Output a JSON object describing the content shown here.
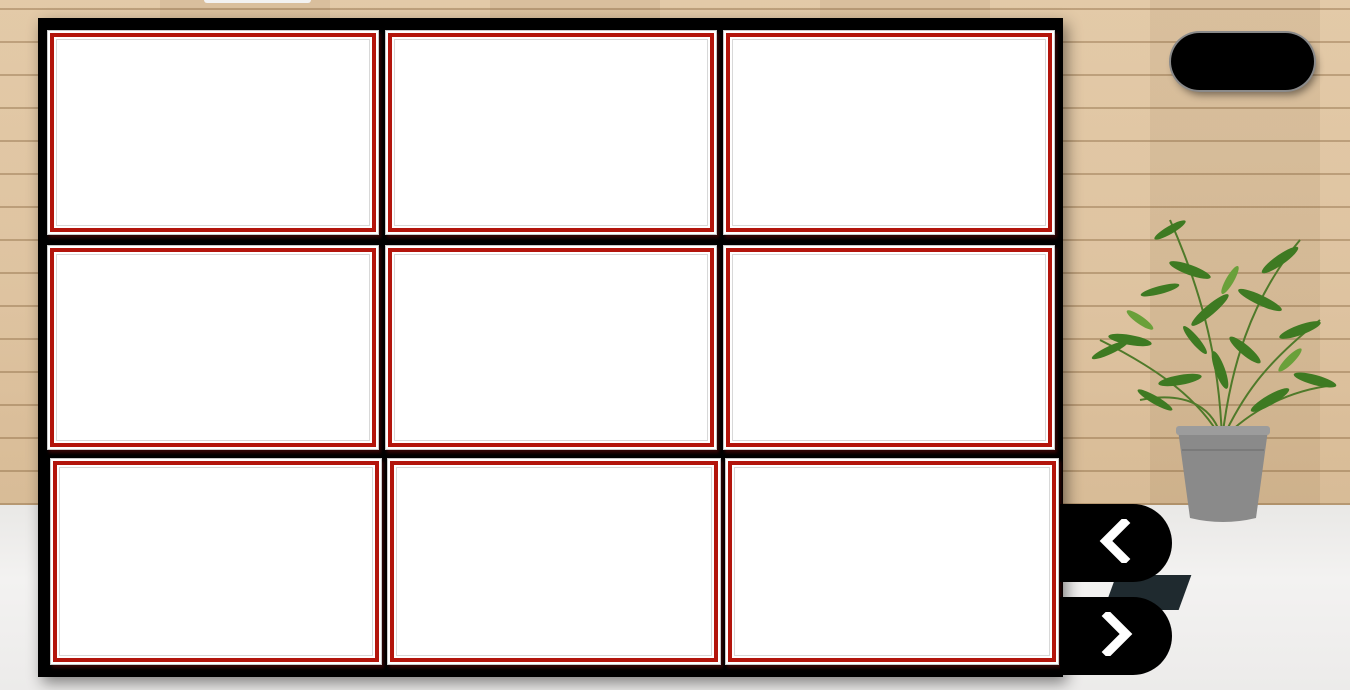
{
  "scene": {
    "background": "wood-wall-and-floor",
    "plant": "potted-plant"
  },
  "board": {
    "color": "#000000",
    "card_border_color": "#b3150c",
    "cards": [
      {
        "label": ""
      },
      {
        "label": ""
      },
      {
        "label": ""
      },
      {
        "label": ""
      },
      {
        "label": ""
      },
      {
        "label": ""
      },
      {
        "label": ""
      },
      {
        "label": ""
      },
      {
        "label": ""
      }
    ]
  },
  "controls": {
    "top_pill_label": "",
    "prev_icon": "chevron-left-icon",
    "next_icon": "chevron-right-icon"
  }
}
